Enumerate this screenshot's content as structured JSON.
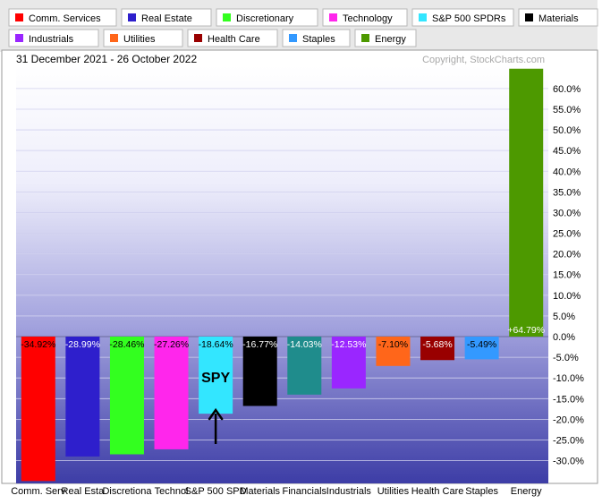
{
  "chart_data": {
    "type": "bar",
    "date_range": "31 December 2021 - 26 October 2022",
    "copyright": "Copyright, StockCharts.com",
    "legend": [
      {
        "label": "Comm. Services",
        "color": "#ff0000"
      },
      {
        "label": "Real Estate",
        "color": "#2e1fcc"
      },
      {
        "label": "Discretionary",
        "color": "#33ff1f"
      },
      {
        "label": "Technology",
        "color": "#ff26ec"
      },
      {
        "label": "S&P 500 SPDRs",
        "color": "#33e6ff"
      },
      {
        "label": "Materials",
        "color": "#000000"
      },
      {
        "label": "Financials",
        "color": "#1f8c8c"
      },
      {
        "label": "Industrials",
        "color": "#9a26ff"
      },
      {
        "label": "Utilities",
        "color": "#ff661a"
      },
      {
        "label": "Health Care",
        "color": "#990000"
      },
      {
        "label": "Staples",
        "color": "#3399ff"
      },
      {
        "label": "Energy",
        "color": "#4d9900"
      }
    ],
    "categories": [
      "Comm. Serv",
      "Real Esta",
      "Discretiona",
      "Technol",
      "S&P 500 SPD",
      "Materials",
      "Financials",
      "Industrials",
      "Utilities",
      "Health Care",
      "Staples",
      "Energy"
    ],
    "values": [
      -34.92,
      -28.99,
      -28.46,
      -27.26,
      -18.64,
      -16.77,
      -14.03,
      -12.53,
      -7.1,
      -5.68,
      -5.49,
      64.79
    ],
    "value_labels": [
      "-34.92%",
      "-28.99%",
      "-28.46%",
      "-27.26%",
      "-18.64%",
      "-16.77%",
      "-14.03%",
      "-12.53%",
      "-7.10%",
      "-5.68%",
      "-5.49%",
      "+64.79%"
    ],
    "colors": [
      "#ff0000",
      "#2e1fcc",
      "#33ff1f",
      "#ff26ec",
      "#33e6ff",
      "#000000",
      "#1f8c8c",
      "#9a26ff",
      "#ff661a",
      "#990000",
      "#3399ff",
      "#4d9900"
    ],
    "label_colors": [
      "#000000",
      "#ffffff",
      "#000000",
      "#000000",
      "#000000",
      "#ffffff",
      "#ffffff",
      "#ffffff",
      "#000000",
      "#ffffff",
      "#000000",
      "#ffffff"
    ],
    "y_ticks": [
      60,
      55,
      50,
      45,
      40,
      35,
      30,
      25,
      20,
      15,
      10,
      5,
      0,
      -5,
      -10,
      -15,
      -20,
      -25,
      -30
    ],
    "y_tick_labels": [
      "60.0%",
      "55.0%",
      "50.0%",
      "45.0%",
      "40.0%",
      "35.0%",
      "30.0%",
      "25.0%",
      "20.0%",
      "15.0%",
      "10.0%",
      "5.0%",
      "0.0%",
      "-5.0%",
      "-10.0%",
      "-15.0%",
      "-20.0%",
      "-25.0%",
      "-30.0%"
    ],
    "ylim": [
      -35.5,
      65.6
    ],
    "annotation": {
      "text": "SPY",
      "category": "S&P 500 SPD"
    },
    "grid": true,
    "legend_position": "top"
  }
}
